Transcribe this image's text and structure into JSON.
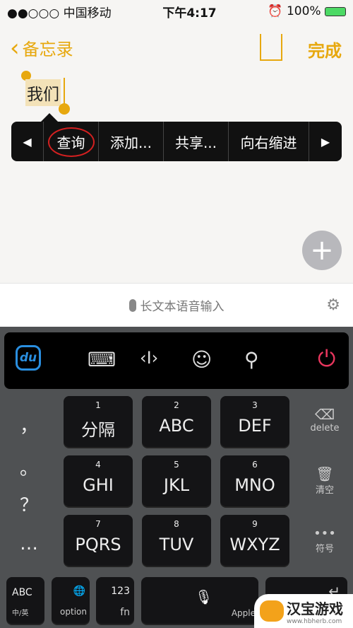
{
  "status": {
    "carrier": "●●○○○ 中国移动",
    "wifi": "wifi-icon",
    "time": "下午4:17",
    "alarm": "alarm-icon",
    "battery": "100%"
  },
  "nav": {
    "back_label": "备忘录",
    "done_label": "完成",
    "share": "share-icon"
  },
  "note": {
    "selected_text": "我们"
  },
  "context_menu": {
    "items": [
      "查询",
      "添加...",
      "共享...",
      "向右缩进"
    ],
    "left": "◀",
    "right": "▶"
  },
  "voice": {
    "label": "长文本语音输入"
  },
  "toolbar": {
    "logo": "du",
    "icons": [
      "keyboard-icon",
      "cursor-icon",
      "emoji-icon",
      "search-icon",
      "power-icon"
    ],
    "power_color": "#e8365d",
    "logo_color": "#2a8fe0"
  },
  "keys": [
    {
      "num": "1",
      "label": "分隔"
    },
    {
      "num": "2",
      "label": "ABC"
    },
    {
      "num": "3",
      "label": "DEF"
    },
    {
      "num": "4",
      "label": "GHI"
    },
    {
      "num": "5",
      "label": "JKL"
    },
    {
      "num": "6",
      "label": "MNO"
    },
    {
      "num": "7",
      "label": "PQRS"
    },
    {
      "num": "8",
      "label": "TUV"
    },
    {
      "num": "9",
      "label": "WXYZ"
    }
  ],
  "left_punct": [
    "，",
    "。",
    "？",
    "…"
  ],
  "right_keys": {
    "delete": "delete",
    "clear": "清空",
    "symbol": "符号"
  },
  "bottom": {
    "abc": "ABC",
    "abc_sub": "中/英",
    "option": "option",
    "num": "123",
    "fn": "fn",
    "space_hint": "Apple"
  },
  "watermark": {
    "title": "汉宝游戏",
    "url": "www.hbherb.com"
  }
}
